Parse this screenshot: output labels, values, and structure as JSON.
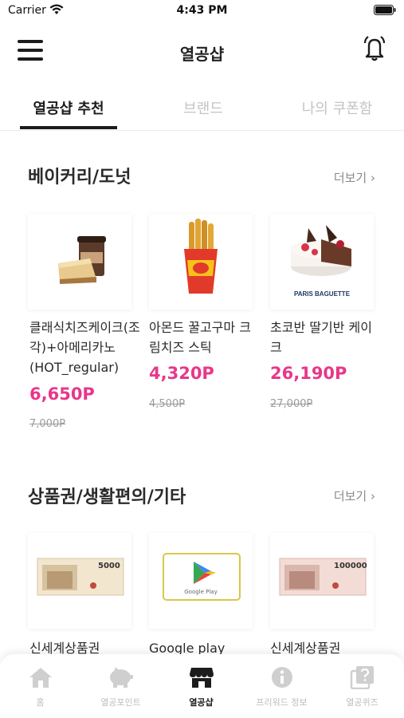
{
  "status_bar": {
    "carrier": "Carrier",
    "time": "4:43 PM"
  },
  "nav": {
    "title": "열공샵"
  },
  "tabs": [
    {
      "label": "열공샵 추천"
    },
    {
      "label": "브랜드"
    },
    {
      "label": "나의 쿠폰함"
    }
  ],
  "sections": [
    {
      "title": "베이커리/도넛",
      "more": "더보기 ›",
      "products": [
        {
          "name": "클래식치즈케이크(조각)+아메리카노(HOT_regular)",
          "price": "6,650P",
          "original": "7,000P"
        },
        {
          "name": "아몬드 꿀고구마 크림치즈 스틱",
          "price": "4,320P",
          "original": "4,500P"
        },
        {
          "name": "초코반 딸기반 케이크",
          "price": "26,190P",
          "original": "27,000P",
          "brand_caption": "PARIS BAGUETTE"
        }
      ]
    },
    {
      "title": "상품권/생활편의/기타",
      "more": "더보기 ›",
      "products": [
        {
          "name": "신세계상품권",
          "voucher_amount": "5000"
        },
        {
          "name": "Google play",
          "card_caption": "Google Play"
        },
        {
          "name": "신세계상품권",
          "voucher_amount": "100000"
        }
      ]
    }
  ],
  "bottom_nav": [
    {
      "label": "홈",
      "icon": "home-icon"
    },
    {
      "label": "열공포인트",
      "icon": "piggy-bank-icon"
    },
    {
      "label": "열공샵",
      "icon": "shop-icon",
      "active": true
    },
    {
      "label": "프리워드 정보",
      "icon": "info-icon"
    },
    {
      "label": "열공퀴즈",
      "icon": "quiz-icon"
    }
  ],
  "colors": {
    "accent_pink": "#e8378a",
    "active_tab": "#1c1c1c",
    "inactive": "#c4c4c4"
  }
}
